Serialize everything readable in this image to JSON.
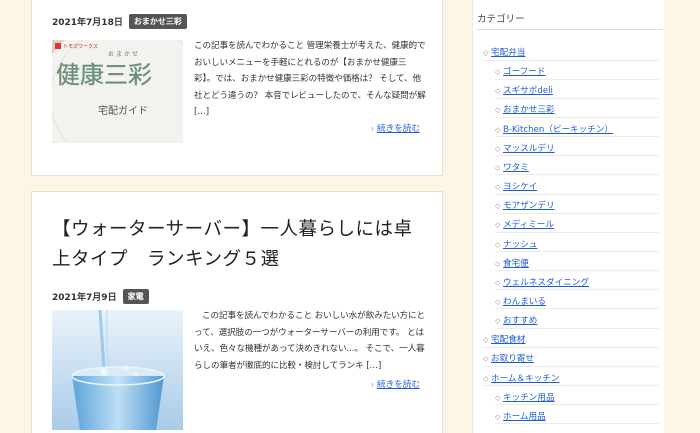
{
  "posts": [
    {
      "date": "2021年7月18日",
      "category": "おまかせ三彩",
      "excerpt": "この記事を読んでわかること 管理栄養士が考えた、健康的でおいしいメニューを手軽にとれるのが【おまかせ健康三彩】。では、おまかせ健康三彩の特徴や価格は？ そして、他社とどう違うの？ 本音でレビューしたので、そんな疑問が解 […]",
      "more": "続きを読む",
      "thumb": {
        "brand": "トモズワークス",
        "small": "おまかせ",
        "main": "健康三彩",
        "sub": "宅配ガイド"
      }
    },
    {
      "title": "【ウォーターサーバー】一人暮らしには卓上タイプ　ランキング５選",
      "date": "2021年7月9日",
      "category": "家電",
      "excerpt": "この記事を読んでわかること おいしい水が飲みたい方にとって、選択肢の一つがウォーターサーバーの利用です。 とはいえ、色々な機種があって決めきれない...。 そこで、一人暮らしの筆者が徹底的に比較・検討してランキ […]",
      "more": "続きを読む"
    }
  ],
  "sidebar": {
    "heading": "カテゴリー",
    "items": [
      {
        "label": "宅配弁当",
        "level": 0
      },
      {
        "label": "ゴーフード",
        "level": 1
      },
      {
        "label": "スギサポdeli",
        "level": 1
      },
      {
        "label": "おまかせ三彩",
        "level": 1
      },
      {
        "label": "B-Kitchen（ビーキッチン）",
        "level": 1
      },
      {
        "label": "マッスルデリ",
        "level": 1
      },
      {
        "label": "ワタミ",
        "level": 1
      },
      {
        "label": "ヨシケイ",
        "level": 1
      },
      {
        "label": "モアザンデリ",
        "level": 1
      },
      {
        "label": "メディミール",
        "level": 1
      },
      {
        "label": "ナッシュ",
        "level": 1
      },
      {
        "label": "食宅便",
        "level": 1
      },
      {
        "label": "ウェルネスダイニング",
        "level": 1
      },
      {
        "label": "わんまいる",
        "level": 1
      },
      {
        "label": "おすすめ",
        "level": 1
      },
      {
        "label": "宅配食材",
        "level": 0
      },
      {
        "label": "お取り寄せ",
        "level": 0
      },
      {
        "label": "ホーム＆キッチン",
        "level": 0
      },
      {
        "label": "キッチン用品",
        "level": 1
      },
      {
        "label": "ホーム用品",
        "level": 1
      }
    ]
  },
  "colors": {
    "background": "#fbf6e6",
    "link": "#1e5bd8",
    "category_badge": "#555555"
  }
}
